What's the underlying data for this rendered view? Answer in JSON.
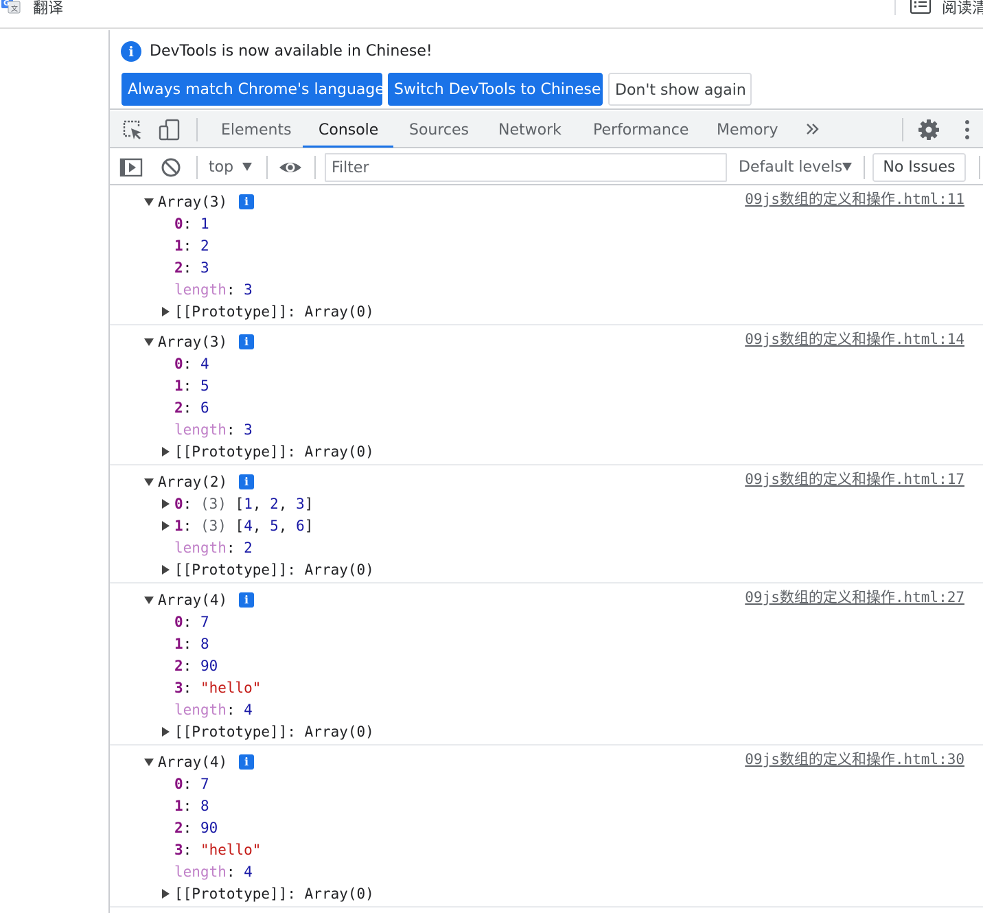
{
  "browser": {
    "translate_label": "翻译",
    "reader_label": "阅读清"
  },
  "infobar": {
    "message": "DevTools is now available in Chinese!",
    "btn_match": "Always match Chrome's language",
    "btn_switch": "Switch DevTools to Chinese",
    "btn_dismiss": "Don't show again"
  },
  "tabs": [
    {
      "label": "Elements"
    },
    {
      "label": "Console"
    },
    {
      "label": "Sources"
    },
    {
      "label": "Network"
    },
    {
      "label": "Performance"
    },
    {
      "label": "Memory"
    }
  ],
  "toolbar": {
    "context": "top",
    "filter_placeholder": "Filter",
    "levels": "Default levels",
    "issues": "No Issues"
  },
  "console": {
    "info_glyph": "i",
    "logs": [
      {
        "header": "Array(3)",
        "source": "09js数组的定义和操作.html:11",
        "entries": [
          {
            "key": "0",
            "value": "1"
          },
          {
            "key": "1",
            "value": "2"
          },
          {
            "key": "2",
            "value": "3"
          }
        ],
        "length_key": "length",
        "length": "3",
        "proto": "[[Prototype]]",
        "proto_value": "Array(0)"
      },
      {
        "header": "Array(3)",
        "source": "09js数组的定义和操作.html:14",
        "entries": [
          {
            "key": "0",
            "value": "4"
          },
          {
            "key": "1",
            "value": "5"
          },
          {
            "key": "2",
            "value": "6"
          }
        ],
        "length_key": "length",
        "length": "3",
        "proto": "[[Prototype]]",
        "proto_value": "Array(0)"
      },
      {
        "header": "Array(2)",
        "source": "09js数组的定义和操作.html:17",
        "nested": [
          {
            "key": "0",
            "count": "(3)",
            "items": [
              "1",
              "2",
              "3"
            ]
          },
          {
            "key": "1",
            "count": "(3)",
            "items": [
              "4",
              "5",
              "6"
            ]
          }
        ],
        "length_key": "length",
        "length": "2",
        "proto": "[[Prototype]]",
        "proto_value": "Array(0)"
      },
      {
        "header": "Array(4)",
        "source": "09js数组的定义和操作.html:27",
        "entries": [
          {
            "key": "0",
            "value": "7"
          },
          {
            "key": "1",
            "value": "8"
          },
          {
            "key": "2",
            "value": "90"
          },
          {
            "key": "3",
            "value": "\"hello\"",
            "string": true
          }
        ],
        "length_key": "length",
        "length": "4",
        "proto": "[[Prototype]]",
        "proto_value": "Array(0)"
      },
      {
        "header": "Array(4)",
        "source": "09js数组的定义和操作.html:30",
        "entries": [
          {
            "key": "0",
            "value": "7"
          },
          {
            "key": "1",
            "value": "8"
          },
          {
            "key": "2",
            "value": "90"
          },
          {
            "key": "3",
            "value": "\"hello\"",
            "string": true
          }
        ],
        "length_key": "length",
        "length": "4",
        "proto": "[[Prototype]]",
        "proto_value": "Array(0)"
      }
    ]
  }
}
